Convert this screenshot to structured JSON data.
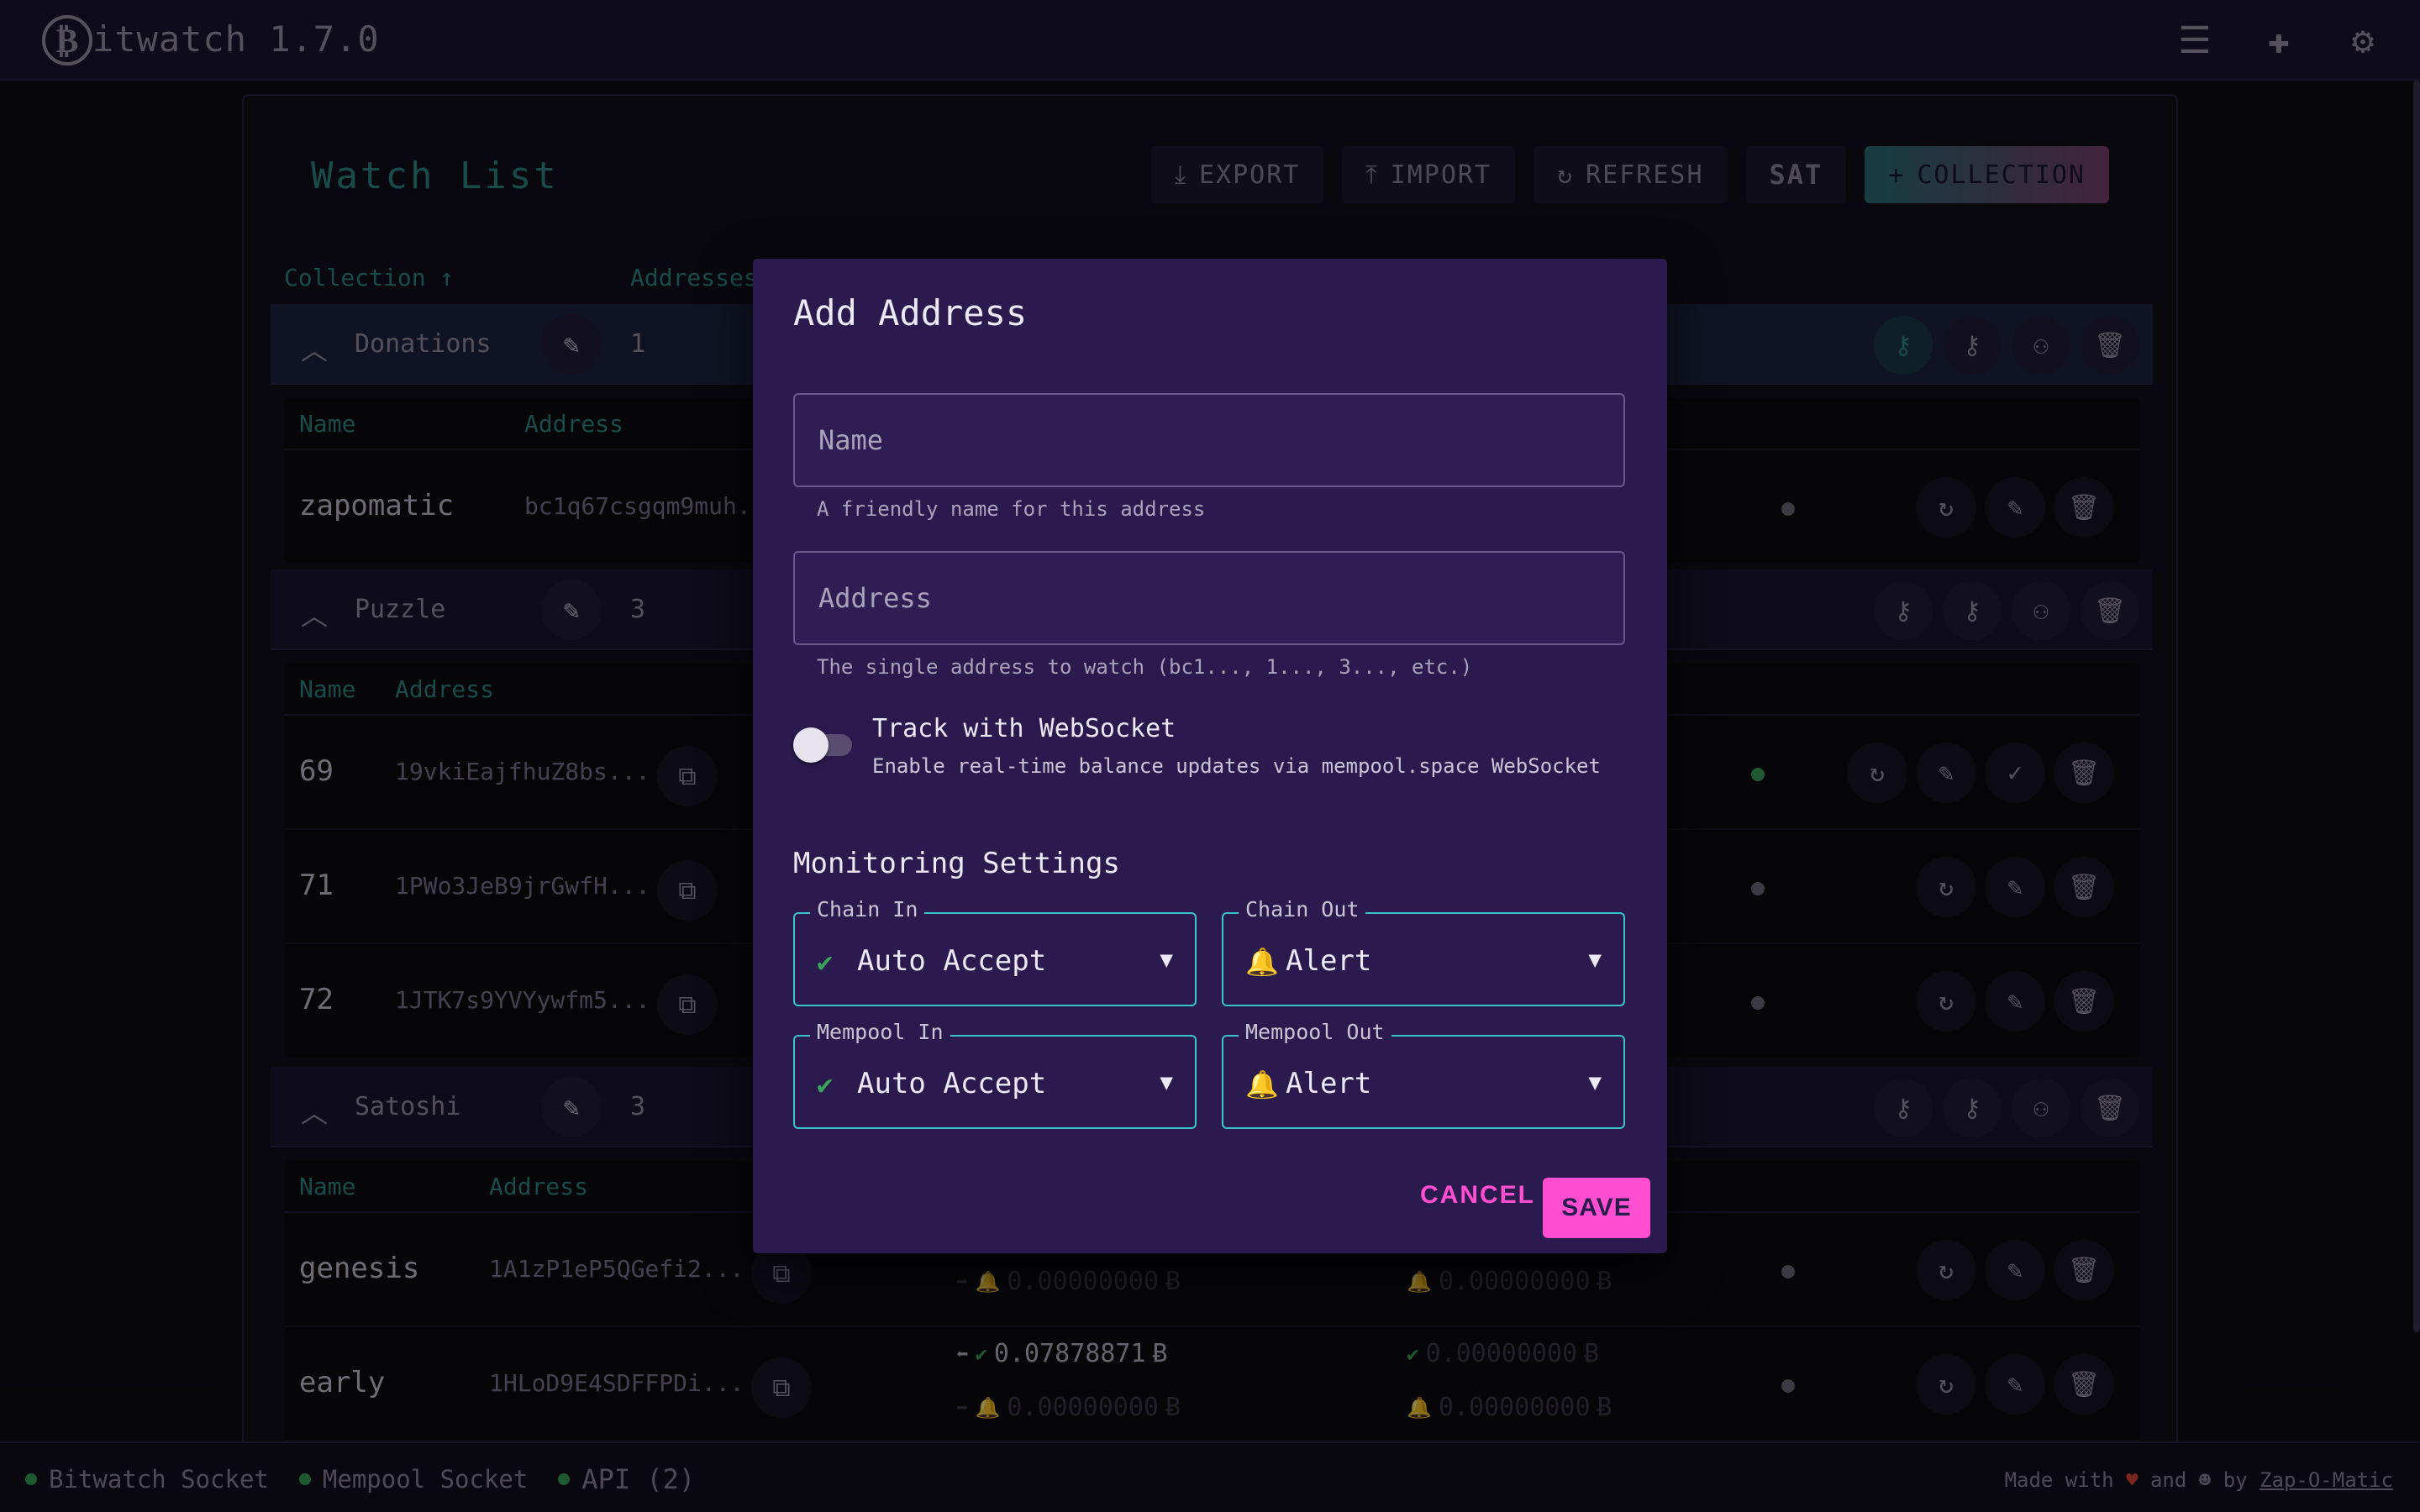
{
  "app": {
    "title": "itwatch 1.7.0",
    "logo_glyph": "₿",
    "version": "1.7.0"
  },
  "top_icons": [
    "list-icon",
    "puzzle-icon",
    "gear-icon"
  ],
  "watch": {
    "title": "Watch List",
    "toolbar": {
      "export": "EXPORT",
      "import": "IMPORT",
      "refresh": "REFRESH",
      "unit": "SAT",
      "collection": "COLLECTION"
    },
    "table_header": {
      "collection": "Collection ↑",
      "addresses": "Addresses"
    },
    "btc_symbol": "Ƀ",
    "groups": [
      {
        "name": "Donations",
        "count": "1",
        "sub_headers": {
          "name": "Name",
          "address": "Address"
        },
        "rows": [
          {
            "name": "zapomatic",
            "address": "bc1q67csgqm9muh..."
          }
        ]
      },
      {
        "name": "Puzzle",
        "count": "3",
        "sub_headers": {
          "name": "Name",
          "address": "Address"
        },
        "rows": [
          {
            "name": "69",
            "address": "19vkiEajfhuZ8bs..."
          },
          {
            "name": "71",
            "address": "1PWo3JeB9jrGwfH..."
          },
          {
            "name": "72",
            "address": "1JTK7s9YVYywfm5..."
          }
        ]
      },
      {
        "name": "Satoshi",
        "count": "3",
        "sub_headers": {
          "name": "Name",
          "address": "Address"
        },
        "rows": [
          {
            "name": "genesis",
            "address": "1A1zP1eP5QGefi2...",
            "in1": "0.00000000",
            "out1": "0.00000000"
          },
          {
            "name": "early",
            "address": "1HLoD9E4SDFFPDi...",
            "in1": "0.07878871",
            "out1": "0.00000000",
            "in2": "0.00000000",
            "out2": "0.00000000"
          }
        ]
      }
    ]
  },
  "dialog": {
    "title": "Add Address",
    "name_placeholder": "Name",
    "name_hint": "A friendly name for this address",
    "address_placeholder": "Address",
    "address_hint": "The single address to watch (bc1..., 1..., 3..., etc.)",
    "websocket_label": "Track with WebSocket",
    "websocket_desc": "Enable real-time balance updates via mempool.space WebSocket",
    "websocket_enabled": false,
    "monitoring_title": "Monitoring Settings",
    "chain_in": {
      "label": "Chain In",
      "value": "Auto Accept",
      "icon": "check-circle-icon"
    },
    "chain_out": {
      "label": "Chain Out",
      "value": "Alert",
      "icon": "bell-icon"
    },
    "mempool_in": {
      "label": "Mempool In",
      "value": "Auto Accept",
      "icon": "check-circle-icon"
    },
    "mempool_out": {
      "label": "Mempool Out",
      "value": "Alert",
      "icon": "bell-icon"
    },
    "cancel": "CANCEL",
    "save": "SAVE"
  },
  "footer": {
    "bitwatch_socket": "Bitwatch Socket",
    "mempool_socket": "Mempool Socket",
    "api": "API (2)",
    "made_with": "Made with",
    "and": "and",
    "by": "by",
    "author": "Zap-O-Matic"
  },
  "colors": {
    "accent": "#2f8a86",
    "primary": "#ff4fd0",
    "dialog_bg": "#2a1a4e",
    "select_border": "#3bc4c8",
    "ok": "#3aa35a",
    "alert": "#e0883a"
  }
}
